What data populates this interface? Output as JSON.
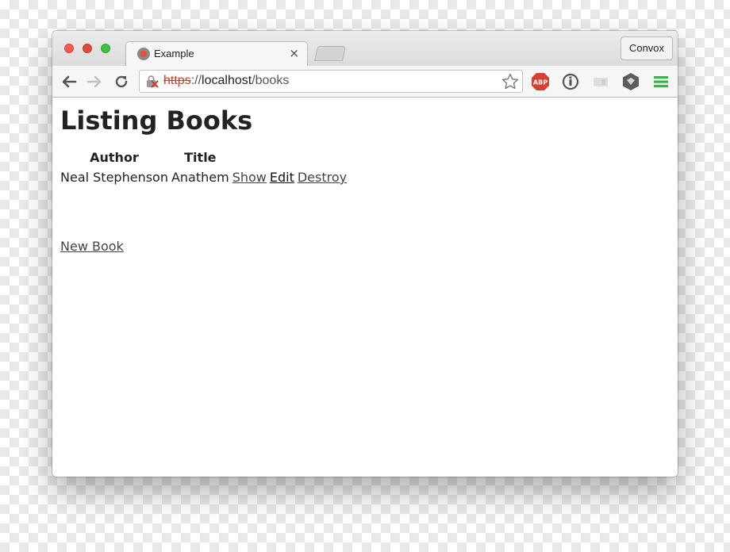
{
  "browser": {
    "tab": {
      "title": "Example",
      "close_glyph": "×"
    },
    "profile_button": "Convox",
    "address": {
      "scheme": "https",
      "separator": "://",
      "host": "localhost",
      "path": "/books",
      "security": "insecure-https"
    },
    "extensions": [
      "adblock-icon",
      "info-icon",
      "grey-extension-icon",
      "hexagon-icon"
    ],
    "colors": {
      "close": "#f25a52",
      "minimize": "#e04a3c",
      "zoom": "#3ec443",
      "menu": "#3ab54a"
    }
  },
  "page": {
    "heading": "Listing Books",
    "table": {
      "headers": [
        "Author",
        "Title"
      ],
      "rows": [
        {
          "author": "Neal Stephenson",
          "title": "Anathem",
          "show": "Show",
          "edit": "Edit",
          "destroy": "Destroy"
        }
      ]
    },
    "new_link": "New Book"
  }
}
